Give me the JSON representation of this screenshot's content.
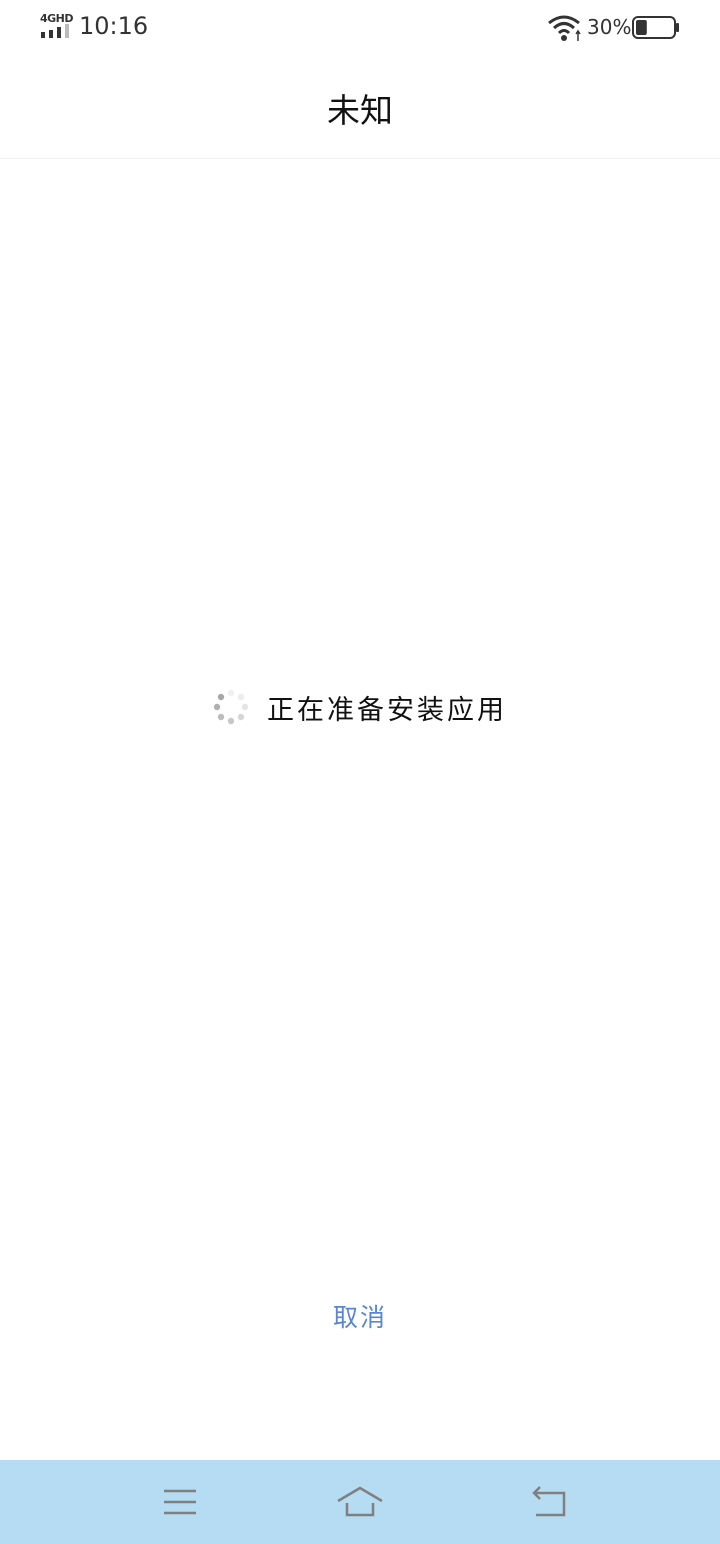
{
  "status_bar": {
    "network_type": "4GHD",
    "time": "10:16",
    "battery_percent": "30%",
    "battery_level": 0.3,
    "icons": [
      "signal-icon",
      "wifi-icon",
      "battery-icon"
    ]
  },
  "header": {
    "title": "未知"
  },
  "main": {
    "loading_text": "正在准备安装应用",
    "spinner_icon": "loading-spinner-icon"
  },
  "footer": {
    "cancel_label": "取消"
  },
  "nav_bar": {
    "icons": [
      "menu-icon",
      "home-icon",
      "back-icon"
    ]
  },
  "colors": {
    "accent": "#5a86d0",
    "nav_background": "#b5dcf2",
    "text": "#111111",
    "nav_icon": "#808080"
  }
}
